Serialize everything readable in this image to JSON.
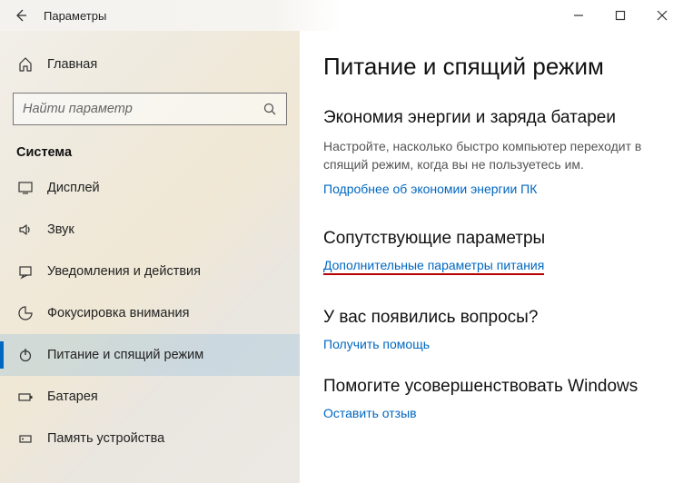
{
  "titlebar": {
    "title": "Параметры"
  },
  "sidebar": {
    "home": "Главная",
    "search_placeholder": "Найти параметр",
    "section": "Система",
    "items": [
      {
        "label": "Дисплей"
      },
      {
        "label": "Звук"
      },
      {
        "label": "Уведомления и действия"
      },
      {
        "label": "Фокусировка внимания"
      },
      {
        "label": "Питание и спящий режим"
      },
      {
        "label": "Батарея"
      },
      {
        "label": "Память устройства"
      }
    ]
  },
  "main": {
    "heading": "Питание и спящий режим",
    "energy": {
      "title": "Экономия энергии и заряда батареи",
      "desc": "Настройте, насколько быстро компьютер переходит в спящий режим, когда вы не пользуетесь им.",
      "link": "Подробнее об экономии энергии ПК"
    },
    "related": {
      "title": "Сопутствующие параметры",
      "link": "Дополнительные параметры питания"
    },
    "help": {
      "title": "У вас появились вопросы?",
      "link": "Получить помощь"
    },
    "feedback": {
      "title": "Помогите усовершенствовать Windows",
      "link": "Оставить отзыв"
    }
  }
}
